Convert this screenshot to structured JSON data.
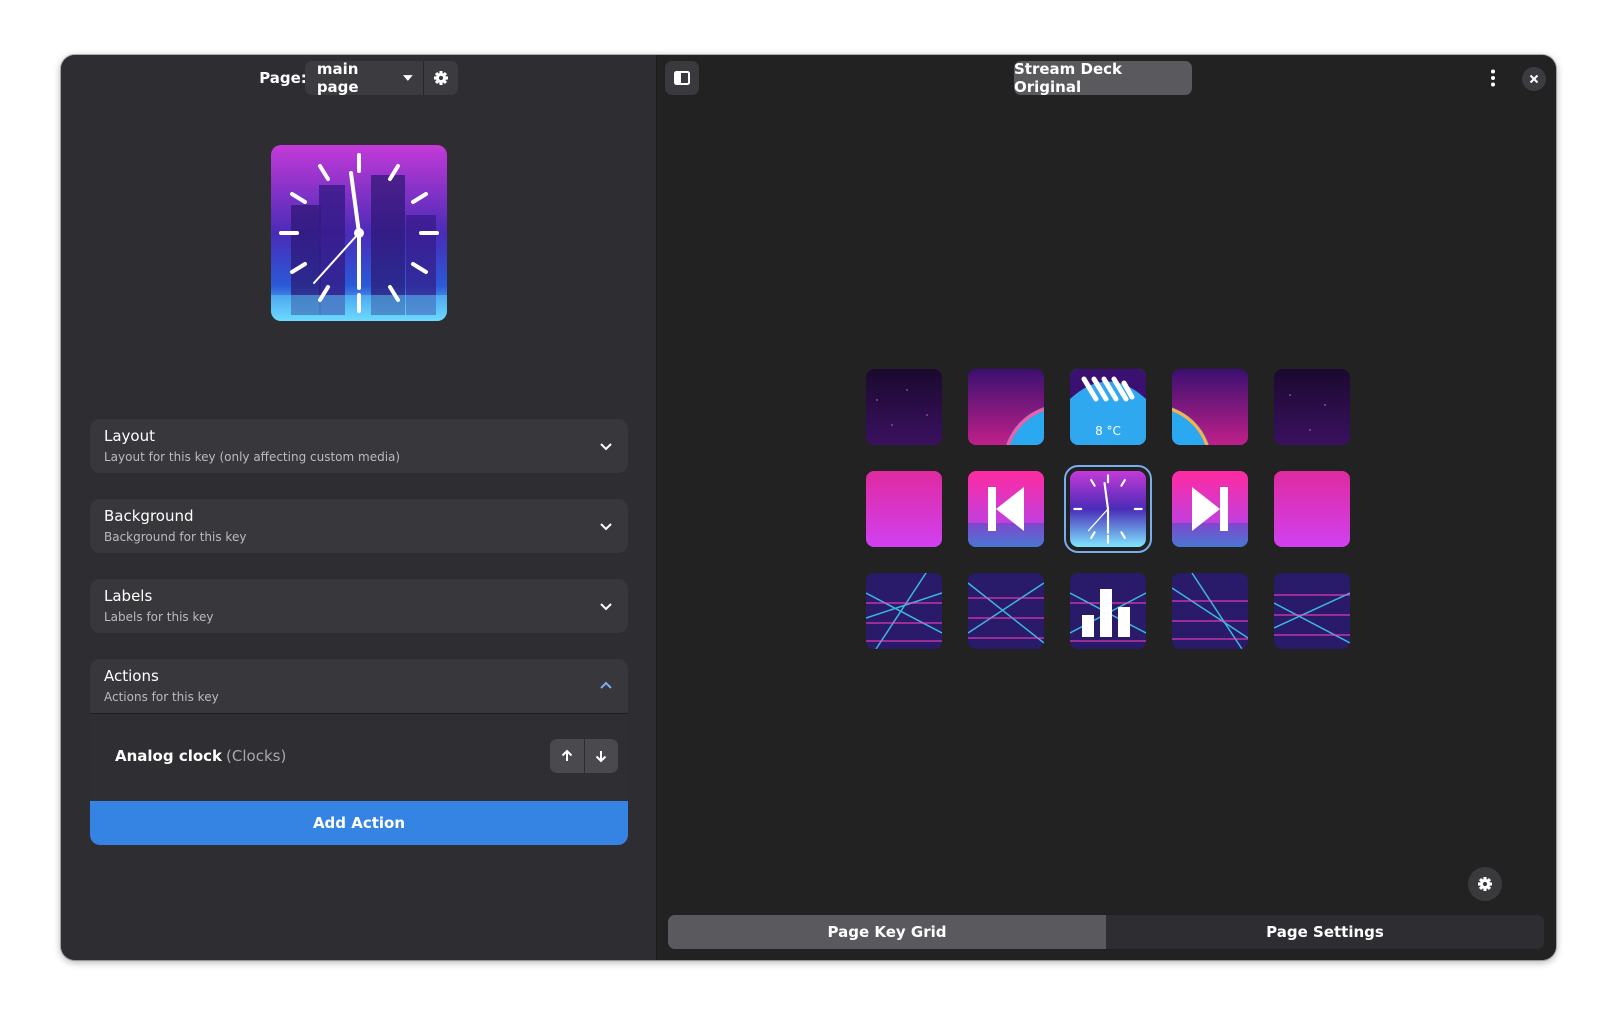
{
  "header": {
    "page_label": "Page:",
    "page_value": "main page",
    "deck_name": "Stream Deck Original"
  },
  "preview": {
    "icon": "analog-clock-icon"
  },
  "expanders": [
    {
      "title": "Layout",
      "subtitle": "Layout for this key (only affecting custom media)",
      "expanded": false
    },
    {
      "title": "Background",
      "subtitle": "Background for this key",
      "expanded": false
    },
    {
      "title": "Labels",
      "subtitle": "Labels for this key",
      "expanded": false
    },
    {
      "title": "Actions",
      "subtitle": "Actions for this key",
      "expanded": true
    }
  ],
  "actions": {
    "items": [
      {
        "name": "Analog clock",
        "category": "(Clocks)"
      }
    ],
    "add_label": "Add Action"
  },
  "grid": {
    "weather_label": "8 °C",
    "selected_index": 7
  },
  "tabs": [
    {
      "label": "Page Key Grid",
      "active": true
    },
    {
      "label": "Page Settings",
      "active": false
    }
  ],
  "colors": {
    "accent": "#3584e4",
    "selection": "#78aeed",
    "window_bg": "#222222",
    "sidebar_bg": "#2e2e32"
  }
}
